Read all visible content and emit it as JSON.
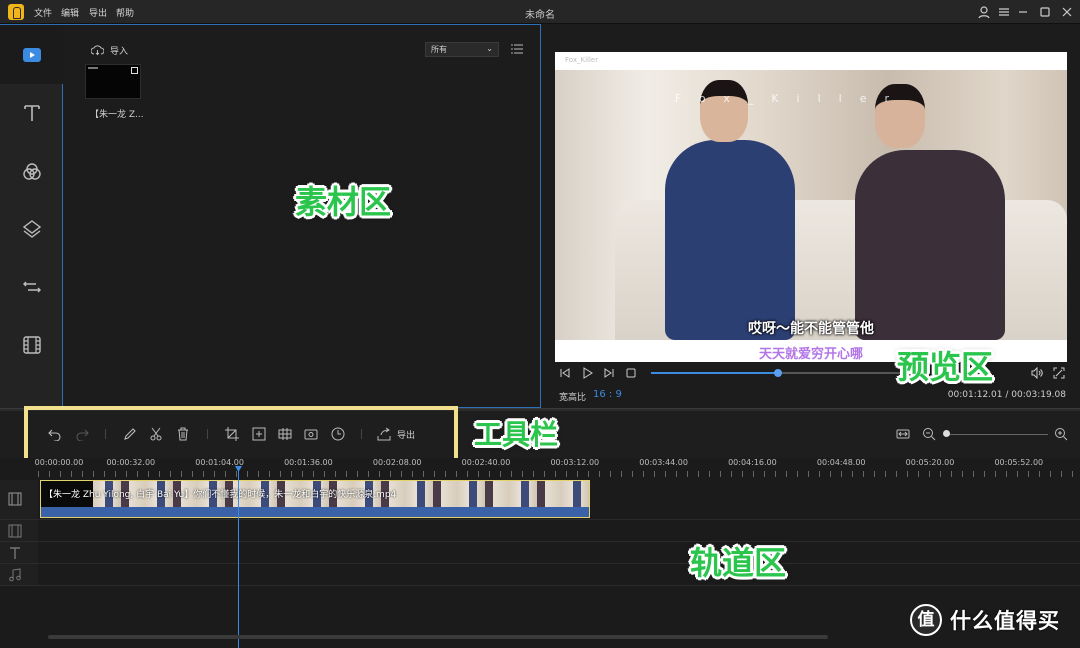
{
  "app": {
    "menus": [
      "文件",
      "编辑",
      "导出",
      "帮助"
    ],
    "title": "未命名"
  },
  "media": {
    "import_label": "导入",
    "filter_value": "所有",
    "clip_name": "【朱一龙 Z...",
    "annotation": "素材区"
  },
  "preview": {
    "watermark_small": "Fox_Killer",
    "watermark_big": "Fox_Killer",
    "subtitle1": "哎呀～能不能管管他",
    "subtitle2": "天天就爱穷开心哪",
    "progress_fraction": 0.46,
    "ratio_label": "宽高比",
    "ratio_value": "16 : 9",
    "timecode": "00:01:12.01 / 00:03:19.08",
    "annotation": "预览区"
  },
  "toolbar": {
    "export_label": "导出",
    "annotation": "工具栏",
    "zoom_fraction": 0.0
  },
  "timeline": {
    "ruler_labels": [
      "00:00:00.00",
      "00:00:32.00",
      "00:01:04.00",
      "00:01:36.00",
      "00:02:08.00",
      "00:02:40.00",
      "00:03:12.00",
      "00:03:44.00",
      "00:04:16.00",
      "00:04:48.00",
      "00:05:20.00",
      "00:05:52.00"
    ],
    "clip_title": "【朱一龙 Zhu Yilong, 白宇 Bai Yu】你们不懂我的时候，朱一龙和白宇的快乐源泉.mp4",
    "annotation": "轨道区"
  },
  "brand": {
    "logo_char": "值",
    "text": "什么值得买"
  },
  "colors": {
    "accent": "#3b8be0",
    "highlight_border": "#f1e08c",
    "annotation_green": "#2bc54e",
    "subtitle_purple": "#b276e6"
  },
  "icons": {
    "sidebar": [
      "media-icon",
      "text-icon",
      "filter-icon",
      "overlay-icon",
      "transition-icon",
      "film-icon"
    ],
    "toolbar": [
      "undo-icon",
      "redo-icon",
      "edit-icon",
      "scissors-icon",
      "trash-icon",
      "crop-icon",
      "zoom-crop-icon",
      "mosaic-icon",
      "freeze-frame-icon",
      "duration-icon",
      "export-icon"
    ]
  }
}
